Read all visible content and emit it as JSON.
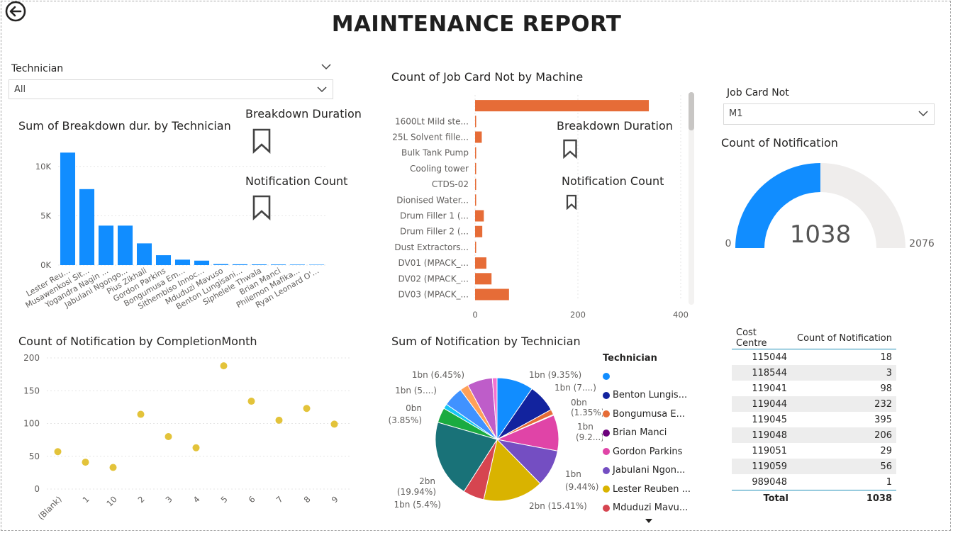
{
  "header": {
    "title": "MAINTENANCE REPORT"
  },
  "technician_slicer": {
    "label": "Technician",
    "value": "All"
  },
  "jobcard_slicer": {
    "label": "Job Card Not",
    "value": "M1"
  },
  "bookmarks": {
    "left": {
      "breakdown": "Breakdown Duration",
      "notification": "Notification Count"
    },
    "middle": {
      "breakdown": "Breakdown Duration",
      "notification": "Notification Count"
    }
  },
  "colors": {
    "blue": "#118dff",
    "orange": "#e66c37",
    "gold": "#e3c33a",
    "gray": "#efedec"
  },
  "chart_data": [
    {
      "id": "breakdown_by_technician",
      "type": "bar",
      "title": "Sum of Breakdown dur. by Technician",
      "categories": [
        "Lester Reu...",
        "Musawenkosi Sit...",
        "Yogandra Nagin ...",
        "Jabulani Ngongo...",
        "Pius Zikhali",
        "Gordon Parkins",
        "Bongumusa Em...",
        "Sithembiso Innoc...",
        "Mduduzi Mavuso",
        "Benton Lungisani...",
        "Siphelele Thwala",
        "Brian Manci",
        "Philemon Mafika...",
        "Ryan Leonard O'..."
      ],
      "values": [
        11400,
        7700,
        4000,
        4000,
        2200,
        1000,
        550,
        450,
        100,
        80,
        70,
        60,
        50,
        40
      ],
      "yticks": [
        "0K",
        "5K",
        "10K"
      ],
      "ylim": [
        0,
        12500
      ]
    },
    {
      "id": "jobcard_by_machine",
      "type": "bar",
      "orientation": "horizontal",
      "title": "Count of Job Card Not by Machine",
      "categories": [
        "",
        "1600Lt Mild ste...",
        "25L Solvent fille...",
        "Bulk Tank Pump",
        "Cooling tower",
        "CTDS-02",
        "Dionised Water...",
        "Drum Filler 1 (...",
        "Drum Filler 2 (...",
        "Dust Extractors...",
        "DV01 (MPACK_...",
        "DV02 (MPACK_...",
        "DV03 (MPACK_..."
      ],
      "values": [
        338,
        2,
        13,
        2,
        1,
        1,
        1,
        17,
        14,
        2,
        22,
        32,
        66
      ],
      "xticks": [
        "0",
        "200",
        "400"
      ],
      "xlim": [
        0,
        400
      ]
    },
    {
      "id": "notification_gauge",
      "type": "gauge",
      "title": "Count of Notification",
      "value": 1038,
      "min": 0,
      "max": 2076,
      "value_label": "1038",
      "min_label": "0",
      "max_label": "2076"
    },
    {
      "id": "notification_by_month",
      "type": "scatter",
      "title": "Count of Notification by CompletionMonth",
      "categories": [
        "(Blank)",
        "1",
        "10",
        "2",
        "3",
        "4",
        "5",
        "6",
        "7",
        "8",
        "9"
      ],
      "values": [
        57,
        41,
        33,
        114,
        80,
        63,
        188,
        134,
        105,
        123,
        99
      ],
      "yticks": [
        "0",
        "50",
        "100",
        "150",
        "200"
      ],
      "ylim": [
        0,
        200
      ]
    },
    {
      "id": "notification_by_technician",
      "type": "pie",
      "title": "Sum of Notification by Technician",
      "legend_title": "Technician",
      "slices": [
        {
          "name": "",
          "value": 9.35,
          "color": "#118dff"
        },
        {
          "name": "Benton Lungis...",
          "value": 7.2,
          "color": "#12239e"
        },
        {
          "name": "Bongumusa E...",
          "value": 1.35,
          "color": "#e66c37"
        },
        {
          "name": "Brian Manci",
          "value": 0.2,
          "color": "#6b007b"
        },
        {
          "name": "Gordon Parkins",
          "value": 9.2,
          "color": "#e044a7"
        },
        {
          "name": "Jabulani Ngon...",
          "value": 9.44,
          "color": "#744ec2"
        },
        {
          "name": "Lester Reuben ...",
          "value": 15.41,
          "color": "#d9b300"
        },
        {
          "name": "Mduduzi Mavu...",
          "value": 5.4,
          "color": "#d64550"
        },
        {
          "name": "",
          "value": 19.94,
          "color": "#197278"
        },
        {
          "name": "",
          "value": 3.85,
          "color": "#1aab40"
        },
        {
          "name": "",
          "value": 1.2,
          "color": "#15c6f4"
        },
        {
          "name": "",
          "value": 5.1,
          "color": "#4092ff"
        },
        {
          "name": "",
          "value": 2.2,
          "color": "#ffa058"
        },
        {
          "name": "",
          "value": 6.45,
          "color": "#be5dc9"
        },
        {
          "name": "",
          "value": 1.2,
          "color": "#f472d0"
        }
      ],
      "labels": [
        "1bn (9.35%)",
        "1bn (7....)",
        "0bn",
        "(1.35%)",
        "1bn",
        "(9.2...)",
        "1bn",
        "(9.44%)",
        "2bn (15.41%)",
        "1bn (5.4%)",
        "2bn",
        "(19.94%)",
        "0bn",
        "(3.85%)",
        "1bn (5....)",
        "1bn (6.45%)"
      ],
      "legend": [
        "",
        "Benton Lungis...",
        "Bongumusa E...",
        "Brian Manci",
        "Gordon Parkins",
        "Jabulani Ngon...",
        "Lester Reuben ...",
        "Mduduzi Mavu..."
      ]
    },
    {
      "id": "cost_centre_table",
      "type": "table",
      "columns": [
        "Cost Centre",
        "Count of Notification"
      ],
      "rows": [
        [
          "115044",
          "18"
        ],
        [
          "118544",
          "3"
        ],
        [
          "119041",
          "98"
        ],
        [
          "119044",
          "232"
        ],
        [
          "119045",
          "395"
        ],
        [
          "119048",
          "206"
        ],
        [
          "119051",
          "29"
        ],
        [
          "119059",
          "56"
        ],
        [
          "989048",
          "1"
        ]
      ],
      "total": [
        "Total",
        "1038"
      ]
    }
  ]
}
